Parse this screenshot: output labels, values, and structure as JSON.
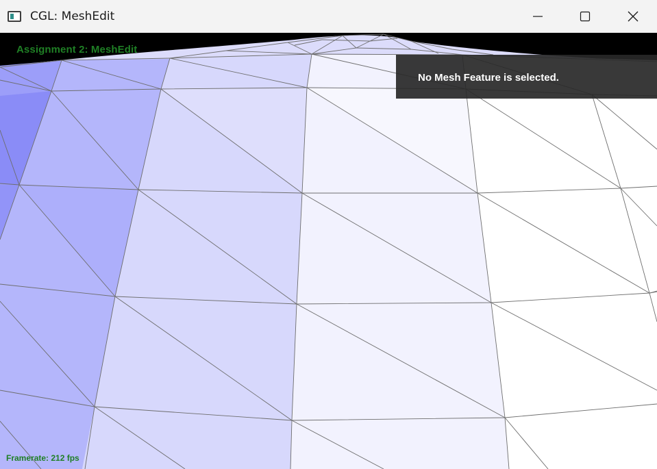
{
  "window": {
    "title": "CGL: MeshEdit",
    "app_icon": "app-window-icon",
    "controls": {
      "minimize_icon": "minimize-icon",
      "maximize_icon": "maximize-icon",
      "close_icon": "close-icon"
    }
  },
  "viewport": {
    "assignment_title": "Assignment 2: MeshEdit",
    "selection_status": "No Mesh Feature is selected.",
    "framerate": "Framerate: 212 fps"
  },
  "colors": {
    "overlay_text": "#1f7f25",
    "panel_background": "#282828",
    "mesh_shade_dark": "#8a8cf7",
    "mesh_shade_light": "#ffffff",
    "mesh_edges": "#6d6d6d",
    "background": "#000000"
  }
}
